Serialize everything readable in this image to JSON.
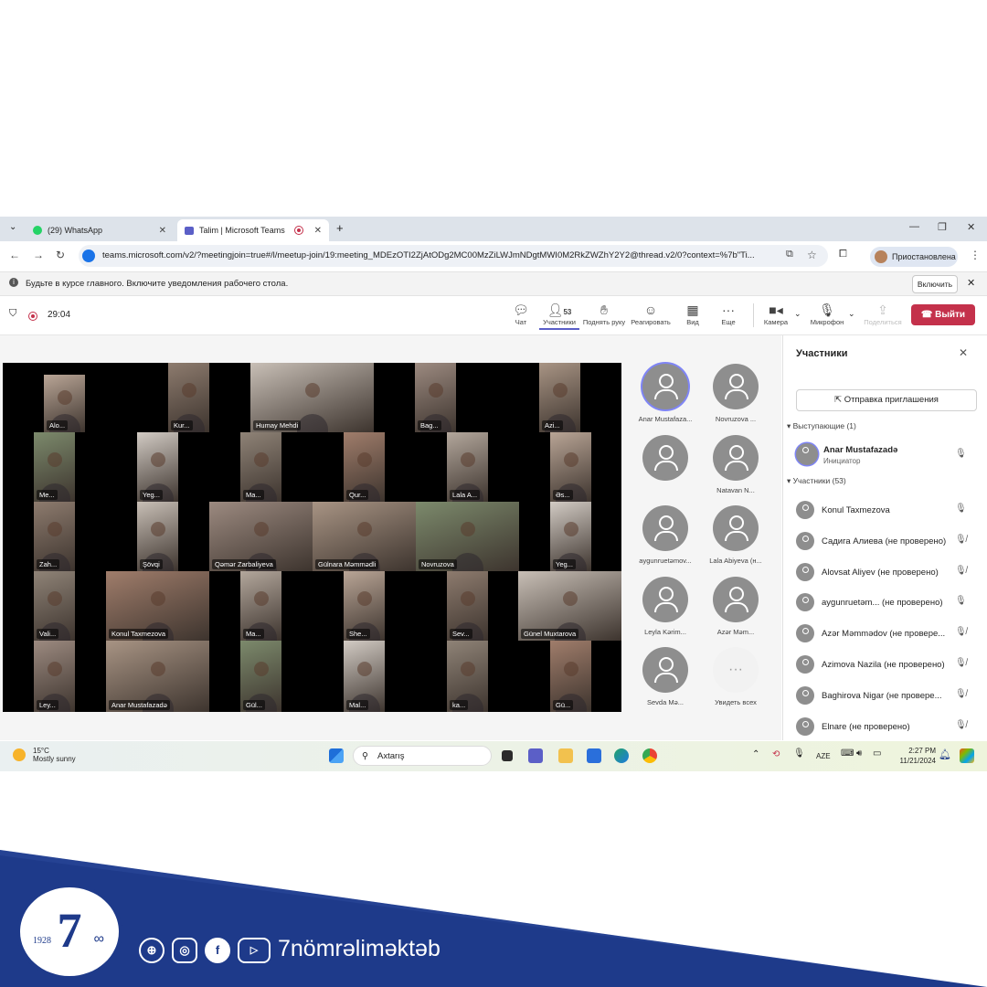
{
  "browser": {
    "tabs": [
      {
        "label": "(29) WhatsApp",
        "icon": "whatsapp-icon"
      },
      {
        "label": "Talim | Microsoft Teams",
        "icon": "teams-icon"
      }
    ],
    "url": "teams.microsoft.com/v2/?meetingjoin=true#/l/meetup-join/19:meeting_MDEzOTI2ZjAtODg2MC00MzZiLWJmNDgtMWI0M2RkZWZhY2Y2@thread.v2/0?context=%7b\"Ti...",
    "profile_label": "Приостановлена"
  },
  "notification": {
    "text": "Будьте в курсе главного. Включите уведомления рабочего стола.",
    "button": "Включить"
  },
  "meeting": {
    "timer": "29:04",
    "participant_count": "53",
    "toolbar": {
      "chat": "Чат",
      "participants": "Участники",
      "raise_hand": "Поднять руку",
      "react": "Реагировать",
      "view": "Вид",
      "more": "Еще",
      "camera": "Камера",
      "mic": "Микрофон",
      "share": "Поделиться",
      "leave": "Выйти"
    }
  },
  "video_tiles": [
    "Alo...",
    "Kur...",
    "Humay Mehdi",
    "Bag...",
    "Azi...",
    "Me...",
    "Yeg...",
    "Ma...",
    "Qur...",
    "Lala A...",
    "Əs...",
    "Zah...",
    "Şövqi",
    "Qəmər Zarbaliyeva",
    "Gülnara Məmmədli",
    "Novruzova",
    "Yeg...",
    "Vali...",
    "Konul Taxmezova",
    "Ma...",
    "She...",
    "Sev...",
    "Günel Muxtarova",
    "Ley...",
    "Anar Mustafazadə",
    "Gül...",
    "Mal...",
    "ka...",
    "Gü..."
  ],
  "avatar_tiles": [
    "Anar Mustafaza...",
    "Novruzova ...",
    "",
    "Natavan N...",
    "aygunruetəmov...",
    "Lala Abiyeva (н...",
    "Leyla Kərim...",
    "Azər Məm...",
    "Sevda Mə...",
    "Увидеть всех"
  ],
  "panel": {
    "title": "Участники",
    "invite": "Отправка приглашения",
    "presenters_header": "Выступающие (1)",
    "presenter": {
      "name": "Anar Mustafazadə",
      "role": "Инициатор"
    },
    "attendees_header": "Участники (53)",
    "attendees": [
      "Konul Taxmezova",
      "Садига Алиева (не проверено)",
      "Alovsat Aliyev (не проверено)",
      "aygunruetəm... (не проверено)",
      "Azər Məmmədov (не провере...",
      "Azimova Nazila (не проверено)",
      "Baghirova Nigar (не провере...",
      "Elnare (не проверено)"
    ]
  },
  "taskbar": {
    "temp": "15°C",
    "weather": "Mostly sunny",
    "search": "Axtarış",
    "lang": "AZE",
    "time": "2:27 PM",
    "date": "11/21/2024"
  },
  "brand": {
    "logo_number": "7",
    "logo_year": "1928",
    "handle": "7nömrəliməktəb"
  },
  "colors": {
    "leave_red": "#c4314b",
    "teams_purple": "#5b5fc7",
    "brand_navy": "#1e3a8a"
  }
}
